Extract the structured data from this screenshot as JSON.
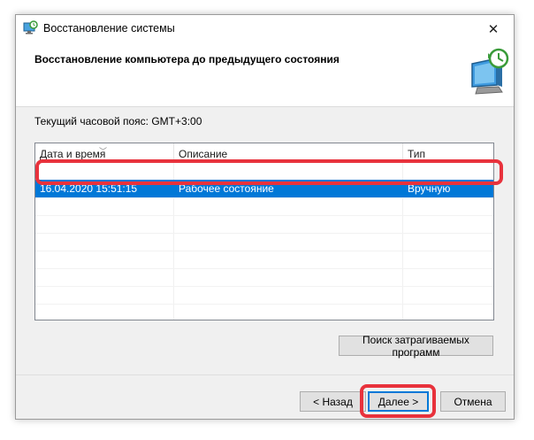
{
  "window": {
    "title": "Восстановление системы",
    "close_glyph": "✕",
    "app_icon": "system-restore-icon"
  },
  "header": {
    "heading": "Восстановление компьютера до предыдущего состояния",
    "icon": "system-restore-monitor-icon"
  },
  "timezone_label": "Текущий часовой пояс: GMT+3:00",
  "list": {
    "columns": [
      "Дата и время",
      "Описание",
      "Тип"
    ],
    "sorted_column": "Дата и время",
    "rows": [
      {
        "date": "16.04.2020 15:51:15",
        "description": "Рабочее состояние",
        "type": "Вручную",
        "selected": true
      }
    ]
  },
  "buttons": {
    "scan": "Поиск затрагиваемых программ",
    "back": "< Назад",
    "next": "Далее >",
    "cancel": "Отмена"
  },
  "colors": {
    "selection": "#0078d7",
    "highlight": "#e8323c",
    "window_bg": "#f0f0f0"
  }
}
